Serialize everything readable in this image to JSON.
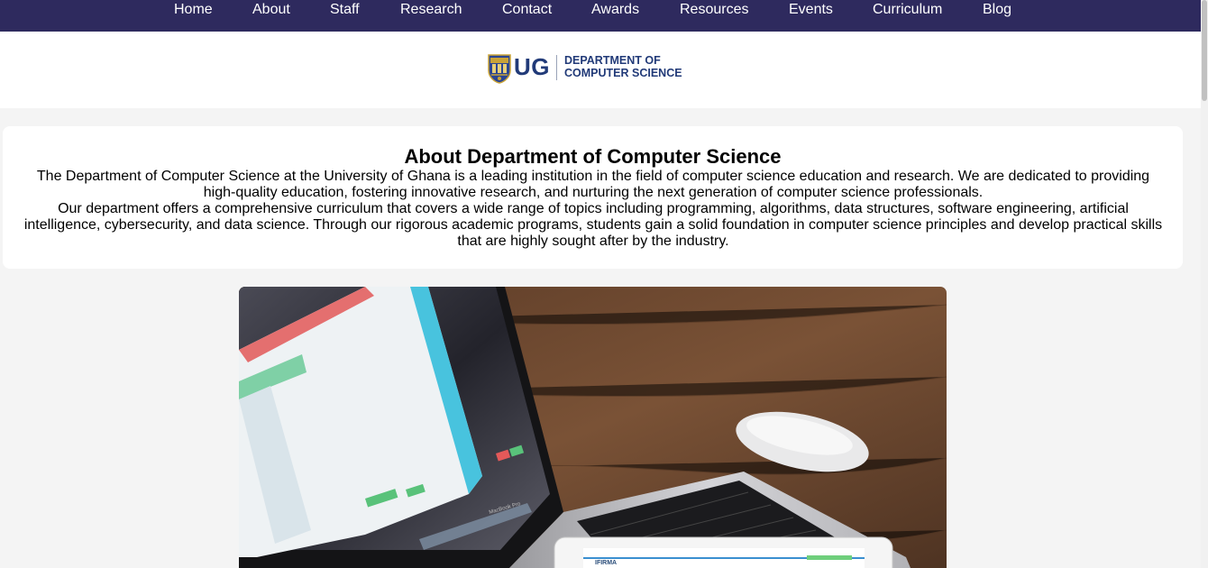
{
  "nav": {
    "items": [
      "Home",
      "About",
      "Staff",
      "Research",
      "Contact",
      "Awards",
      "Resources",
      "Events",
      "Curriculum",
      "Blog"
    ]
  },
  "logo": {
    "abbr": "UG",
    "dept_line1": "DEPARTMENT OF",
    "dept_line2": "COMPUTER SCIENCE"
  },
  "about": {
    "title": "About Department of Computer Science",
    "paragraph1": "The Department of Computer Science at the University of Ghana is a leading institution in the field of computer science education and research. We are dedicated to providing high-quality education, fostering innovative research, and nurturing the next generation of computer science professionals.",
    "paragraph2": "Our department offers a comprehensive curriculum that covers a wide range of topics including programming, algorithms, data structures, software engineering, artificial intelligence, cybersecurity, and data science. Through our rigorous academic programs, students gain a solid foundation in computer science principles and develop practical skills that are highly sought after by the industry."
  },
  "hero": {
    "laptop_brand": "MacBook Pro",
    "tablet_brand": "IFIRMA"
  },
  "colors": {
    "navbar": "#2e2a5e",
    "brand_blue": "#213a78",
    "page_bg": "#f4f4f4"
  }
}
